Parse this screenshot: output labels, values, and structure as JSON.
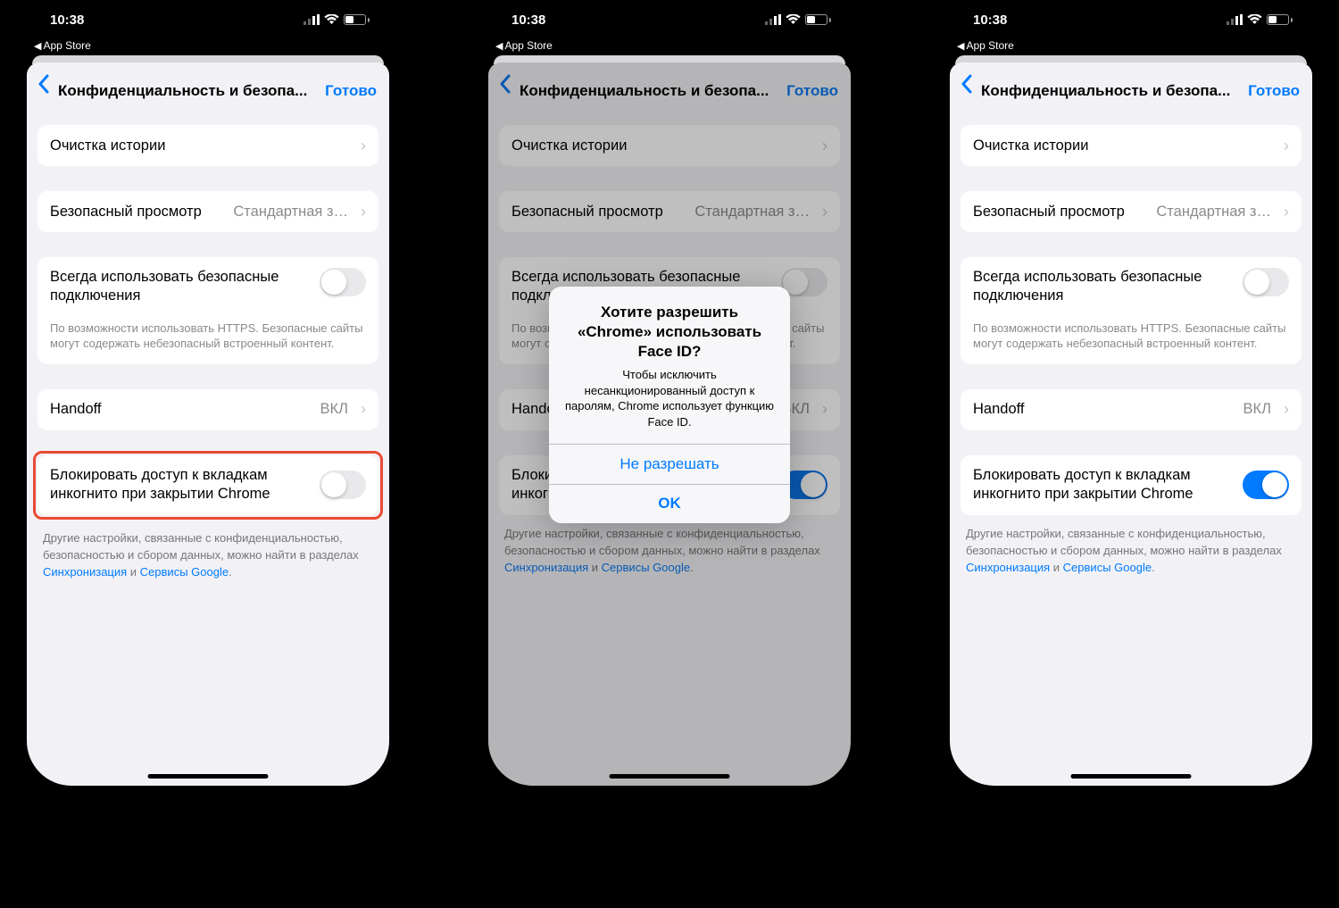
{
  "statusbar": {
    "time": "10:38",
    "breadcrumb_app": "App Store",
    "battery_level": "40"
  },
  "nav": {
    "title": "Конфиденциальность и безопа...",
    "done": "Готово"
  },
  "cells": {
    "clear_history": "Очистка истории",
    "safe_browsing_label": "Безопасный просмотр",
    "safe_browsing_value": "Стандартная з…",
    "https_title": "Всегда использовать безопасные подключения",
    "https_sub": "По возможности использовать HTTPS. Безопасные сайты могут содержать небезопасный встроенный контент.",
    "handoff_label": "Handoff",
    "handoff_value": "ВКЛ",
    "lock_incognito": "Блокировать доступ к вкладкам инкогнито при закрытии Chrome"
  },
  "footer": {
    "pre": "Другие настройки, связанные с конфиденциальностью, безопасностью и сбором данных, можно найти в разделах ",
    "link1": "Синхронизация",
    "mid": " и ",
    "link2": "Сервисы Google",
    "end": "."
  },
  "alert": {
    "title": "Хотите разрешить «Chrome» использовать Face ID?",
    "message": "Чтобы исключить несанкционированный доступ к паролям, Chrome использует функцию Face ID.",
    "deny": "Не разрешать",
    "ok": "OK"
  }
}
